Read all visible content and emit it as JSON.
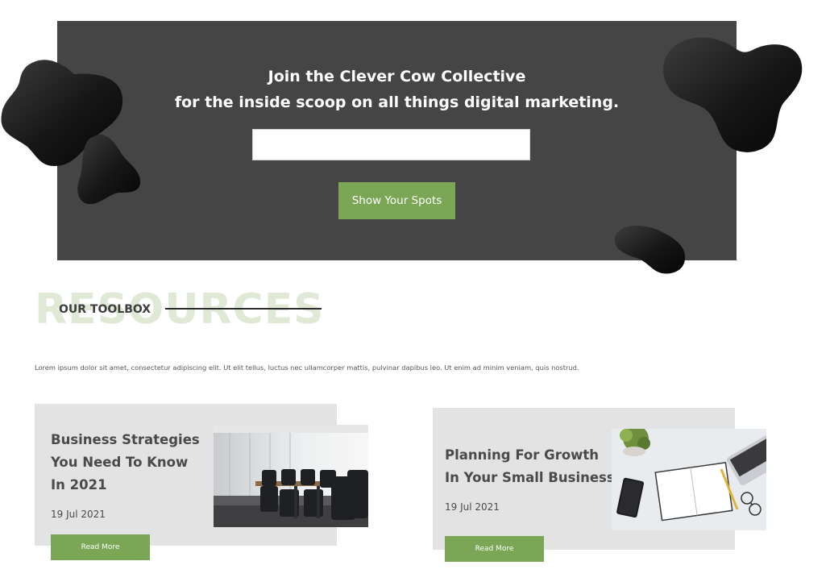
{
  "newsletter": {
    "title_line1": "Join the Clever Cow Collective",
    "title_line2": "for the inside scoop on all things digital marketing.",
    "email_value": "",
    "email_placeholder": "",
    "button_label": "Show Your Spots"
  },
  "section": {
    "background_word": "RESOURCES",
    "label": "OUR TOOLBOX",
    "intro": "Lorem ipsum dolor sit amet, consectetur adipiscing elit. Ut elit tellus, luctus nec ullamcorper mattis, pulvinar dapibus leo. Ut enim ad minim veniam, quis nostrud."
  },
  "posts": [
    {
      "title_lines": [
        "Business Strategies",
        "You Need To Know",
        "In 2021"
      ],
      "date": "19 Jul 2021",
      "button_label": "Read More",
      "image": "conference-room-photo"
    },
    {
      "title_lines": [
        "Planning For Growth",
        "In Your Small Business"
      ],
      "date": "19 Jul 2021",
      "button_label": "Read More",
      "image": "desk-notebook-phone-photo"
    }
  ],
  "colors": {
    "hero_bg": "#454545",
    "accent_green": "#7aa655",
    "card_bg": "#e3e3e3",
    "watermark_green": "#dfe9d6"
  }
}
